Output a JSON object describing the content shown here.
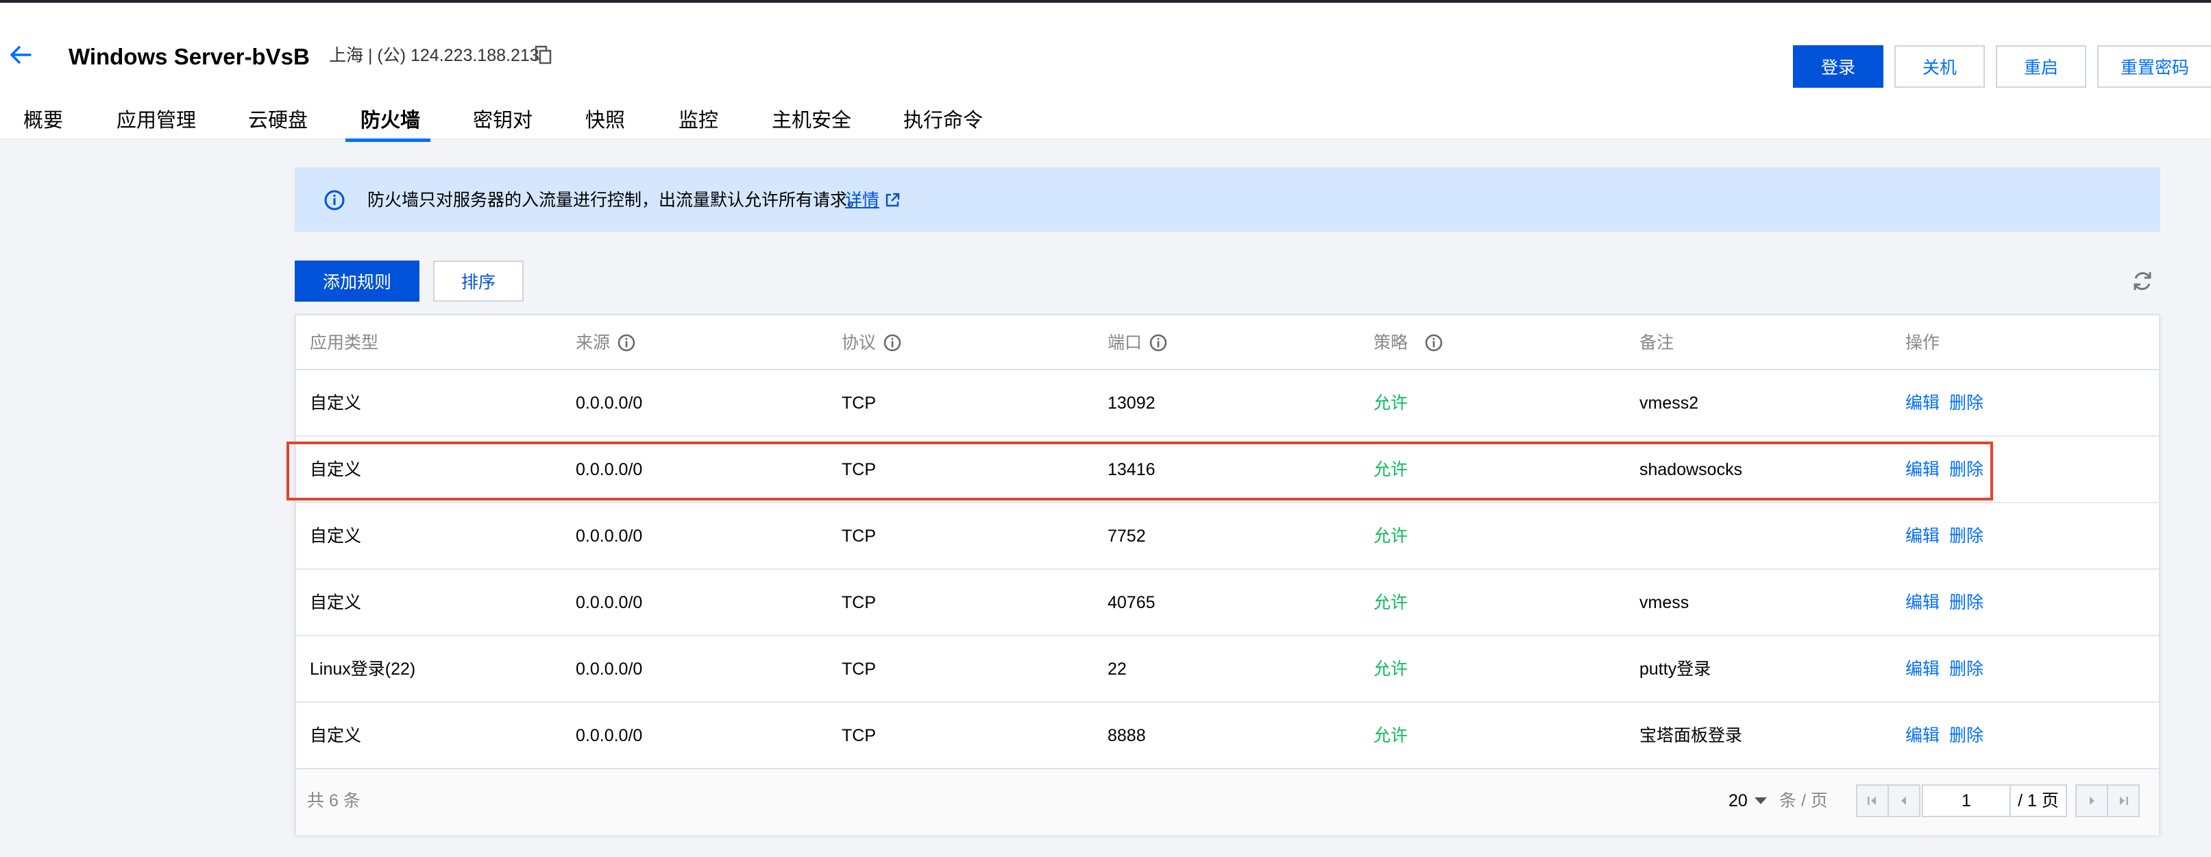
{
  "header": {
    "title": "Windows Server-bVsB",
    "location": "上海 | (公) 124.223.188.213",
    "buttons": {
      "login": "登录",
      "shutdown": "关机",
      "restart": "重启",
      "reset_password": "重置密码"
    }
  },
  "tabs": [
    "概要",
    "应用管理",
    "云硬盘",
    "防火墙",
    "密钥对",
    "快照",
    "监控",
    "主机安全",
    "执行命令"
  ],
  "active_tab": "防火墙",
  "notice": {
    "text": "防火墙只对服务器的入流量进行控制，出流量默认允许所有请求。",
    "link": "详情"
  },
  "toolbar": {
    "add_rule": "添加规则",
    "sort": "排序"
  },
  "table": {
    "columns": [
      "应用类型",
      "来源",
      "协议",
      "端口",
      "策略",
      "备注",
      "操作"
    ],
    "rows": [
      {
        "app": "自定义",
        "source": "0.0.0.0/0",
        "protocol": "TCP",
        "port": "13092",
        "policy": "允许",
        "remark": "vmess2",
        "edit": "编辑",
        "delete": "删除"
      },
      {
        "app": "自定义",
        "source": "0.0.0.0/0",
        "protocol": "TCP",
        "port": "13416",
        "policy": "允许",
        "remark": "shadowsocks",
        "edit": "编辑",
        "delete": "删除"
      },
      {
        "app": "自定义",
        "source": "0.0.0.0/0",
        "protocol": "TCP",
        "port": "7752",
        "policy": "允许",
        "remark": "",
        "edit": "编辑",
        "delete": "删除"
      },
      {
        "app": "自定义",
        "source": "0.0.0.0/0",
        "protocol": "TCP",
        "port": "40765",
        "policy": "允许",
        "remark": "vmess",
        "edit": "编辑",
        "delete": "删除"
      },
      {
        "app": "Linux登录(22)",
        "source": "0.0.0.0/0",
        "protocol": "TCP",
        "port": "22",
        "policy": "允许",
        "remark": "putty登录",
        "edit": "编辑",
        "delete": "删除"
      },
      {
        "app": "自定义",
        "source": "0.0.0.0/0",
        "protocol": "TCP",
        "port": "8888",
        "policy": "允许",
        "remark": "宝塔面板登录",
        "edit": "编辑",
        "delete": "删除"
      }
    ]
  },
  "pagination": {
    "total": "共 6 条",
    "page_size": "20",
    "per_page_label": "条 / 页",
    "current_page": "1",
    "total_pages": "/ 1 页"
  },
  "colors": {
    "primary": "#0052d9",
    "link": "#006eff",
    "allow": "#0abf5b",
    "notice_bg": "#d5e7ff",
    "highlight": "#e2452a"
  }
}
